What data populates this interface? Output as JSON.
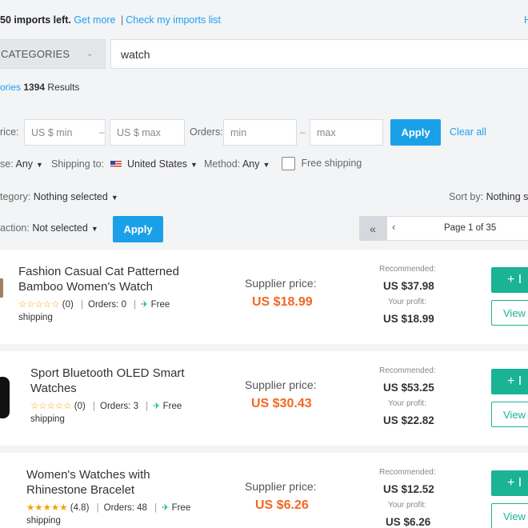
{
  "top": {
    "imports_left": "50 imports left.",
    "get_more": "Get more",
    "separator": "|",
    "check_imports": "Check my imports list",
    "right_link": "H"
  },
  "search": {
    "category_label": "CATEGORIES",
    "query": "watch"
  },
  "results": {
    "categories_link": "ories",
    "count": "1394",
    "results_label": "Results"
  },
  "filters": {
    "price_label": "rice:",
    "price_min_placeholder": "US $ min",
    "price_max_placeholder": "US $ max",
    "orders_label": "Orders:",
    "orders_min_placeholder": "min",
    "orders_max_placeholder": "max",
    "dash": "–",
    "apply_label": "Apply",
    "clear_all": "Clear all",
    "rating_label": "se:",
    "rating_value": "Any",
    "shipping_to_label": "Shipping to:",
    "shipping_to_value": "United States",
    "method_label": "Method:",
    "method_value": "Any",
    "free_shipping_label": "Free shipping",
    "category_label": "tegory:",
    "category_value": "Nothing selected",
    "sort_label": "Sort by:",
    "sort_value": "Nothing s",
    "bulk_label": "action:",
    "bulk_value": "Not selected",
    "bulk_apply": "Apply"
  },
  "pager": {
    "first_icon": "«",
    "prev_icon": "‹",
    "page_text": "Page 1 of 35"
  },
  "products": [
    {
      "title": "Fashion Casual Cat Patterned Bamboo Women's Watch",
      "stars": "☆☆☆☆☆",
      "rating": "(0)",
      "orders": "Orders: 0",
      "free": "Free",
      "shipping": "shipping",
      "supplier_label": "Supplier price:",
      "supplier_price": "US $18.99",
      "recommended_label": "Recommended:",
      "recommended": "US $37.98",
      "profit_label": "Your profit:",
      "profit": "US $18.99",
      "import_label": "+ I",
      "view_label": "View"
    },
    {
      "title": "Sport Bluetooth OLED Smart Watches",
      "stars": "☆☆☆☆☆",
      "rating": "(0)",
      "orders": "Orders: 3",
      "free": "Free",
      "shipping": "shipping",
      "supplier_label": "Supplier price:",
      "supplier_price": "US $30.43",
      "recommended_label": "Recommended:",
      "recommended": "US $53.25",
      "profit_label": "Your profit:",
      "profit": "US $22.82",
      "import_label": "+ I",
      "view_label": "View"
    },
    {
      "title": "Women's Watches with Rhinestone Bracelet",
      "stars": "★★★★★",
      "rating": "(4.8)",
      "orders": "Orders: 48",
      "free": "Free",
      "shipping": "shipping",
      "supplier_label": "Supplier price:",
      "supplier_price": "US $6.26",
      "recommended_label": "Recommended:",
      "recommended": "US $12.52",
      "profit_label": "Your profit:",
      "profit": "US $6.26",
      "import_label": "+ I",
      "view_label": "View"
    }
  ],
  "colors": {
    "accent_blue": "#1aa0e8",
    "accent_green": "#1ab394",
    "price_orange": "#f46722"
  }
}
